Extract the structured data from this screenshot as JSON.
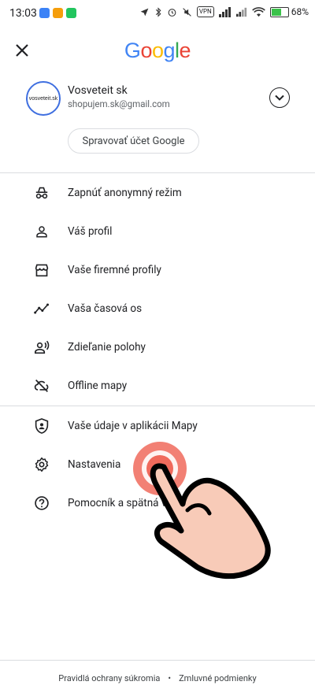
{
  "status_bar": {
    "time": "13:03",
    "vpn_label": "VPN",
    "battery_percent": "68%",
    "battery_level": 0.68
  },
  "header": {
    "logo_text": "Google"
  },
  "account": {
    "avatar_text": "vosveteit.sk",
    "name": "Vosveteit sk",
    "email": "shopujem.sk@gmail.com",
    "manage_label": "Spravovať účet Google"
  },
  "menu_group1": [
    {
      "label": "Zapnúť anonymný režim",
      "icon": "incognito-icon"
    },
    {
      "label": "Váš profil",
      "icon": "person-icon"
    },
    {
      "label": "Vaše firemné profily",
      "icon": "storefront-icon"
    },
    {
      "label": "Vaša časová os",
      "icon": "timeline-icon"
    },
    {
      "label": "Zdieľanie polohy",
      "icon": "location-sharing-icon"
    },
    {
      "label": "Offline mapy",
      "icon": "cloud-off-icon"
    }
  ],
  "menu_group2": [
    {
      "label": "Vaše údaje v aplikácii Mapy",
      "icon": "shield-person-icon"
    },
    {
      "label": "Nastavenia",
      "icon": "gear-icon"
    },
    {
      "label": "Pomocník a spätná väzba",
      "icon": "help-icon"
    }
  ],
  "footer": {
    "privacy": "Pravidlá ochrany súkromia",
    "separator": "•",
    "terms": "Zmluvné podmienky"
  },
  "colors": {
    "google_blue": "#4285F4",
    "google_red": "#EA4335",
    "google_yellow": "#FBBC05",
    "google_green": "#34A853",
    "tap_indicator": "#f06a5c",
    "hand_fill": "#f8cbb8"
  }
}
